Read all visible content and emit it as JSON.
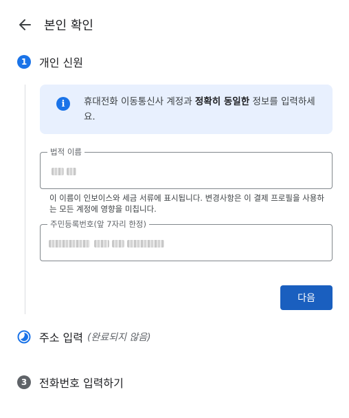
{
  "header": {
    "title": "본인 확인",
    "back_icon": "arrow-left-icon"
  },
  "steps": [
    {
      "number": "1",
      "label": "개인 신원",
      "state": "active",
      "color": "#1a73e8"
    },
    {
      "label": "주소 입력",
      "sub": "(완료되지 않음)",
      "state": "in-progress",
      "color": "#1a73e8"
    },
    {
      "number": "3",
      "label": "전화번호 입력하기",
      "state": "pending",
      "color": "#5f6368"
    }
  ],
  "info": {
    "icon": "info-icon",
    "text_before": "휴대전화 이동통신사 계정과 ",
    "text_bold": "정확히 동일한",
    "text_after": " 정보를 입력하세요."
  },
  "fields": {
    "legal_name": {
      "label": "법적 이름",
      "value_redacted": true
    },
    "legal_name_helper": "이 이름이 인보이스와 세금 서류에 표시됩니다. 변경사항은 이 결제 프로필을 사용하는 모든 계정에 영향을 미칩니다.",
    "resident_id": {
      "label": "주민등록번호(앞 7자리 한정)",
      "value_redacted": true
    }
  },
  "actions": {
    "next_label": "다음"
  },
  "colors": {
    "accent": "#1a73e8",
    "button": "#1a5fbf",
    "info_bg": "#e8f0fe"
  }
}
